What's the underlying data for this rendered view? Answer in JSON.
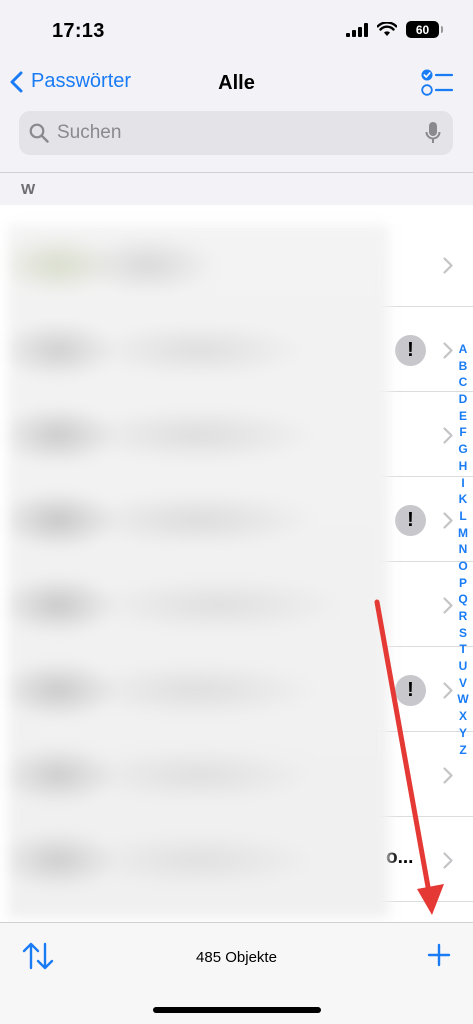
{
  "status_bar": {
    "time": "17:13",
    "battery": "60"
  },
  "nav": {
    "back_label": "Passwörter",
    "title": "Alle"
  },
  "search": {
    "placeholder": "Suchen",
    "value": ""
  },
  "section": {
    "header": "W"
  },
  "rows": [
    {
      "alert": false,
      "trailing_text": ""
    },
    {
      "alert": true,
      "trailing_text": ""
    },
    {
      "alert": false,
      "trailing_text": ""
    },
    {
      "alert": true,
      "trailing_text": ""
    },
    {
      "alert": false,
      "trailing_text": ""
    },
    {
      "alert": true,
      "trailing_text": ""
    },
    {
      "alert": false,
      "trailing_text": ""
    },
    {
      "alert": false,
      "trailing_text": "o..."
    }
  ],
  "alert_symbol": "!",
  "index_letters": [
    "A",
    "B",
    "C",
    "D",
    "E",
    "F",
    "G",
    "H",
    "I",
    "K",
    "L",
    "M",
    "N",
    "O",
    "P",
    "Q",
    "R",
    "S",
    "T",
    "U",
    "V",
    "W",
    "X",
    "Y",
    "Z"
  ],
  "toolbar": {
    "count_label": "485 Objekte"
  },
  "colors": {
    "accent": "#1a7cf5",
    "annotation_arrow": "#e53935"
  },
  "icons": {
    "back": "chevron-left-icon",
    "select": "checklist-icon",
    "search": "search-icon",
    "mic": "microphone-icon",
    "row": "chevron-right-icon",
    "alert": "exclamation-icon",
    "sort": "sort-arrows-icon",
    "add": "plus-icon"
  }
}
